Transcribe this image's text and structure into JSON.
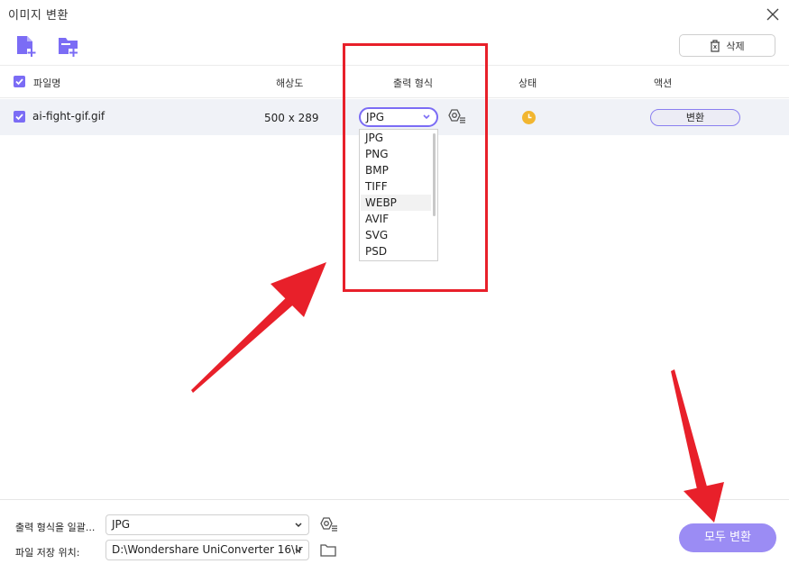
{
  "window": {
    "title": "이미지 변환"
  },
  "toolbar": {
    "add_file_icon": "add-file-icon",
    "add_folder_icon": "add-folder-icon",
    "delete_label": "삭제"
  },
  "table": {
    "headers": {
      "filename": "파일명",
      "resolution": "해상도",
      "output_format": "출력 형식",
      "status": "상태",
      "action": "액션"
    },
    "rows": [
      {
        "filename": "ai-fight-gif.gif",
        "resolution": "500 x 289",
        "format": "JPG",
        "action_label": "변환",
        "checked": true
      }
    ]
  },
  "format_dropdown": {
    "options": [
      "JPG",
      "PNG",
      "BMP",
      "TIFF",
      "WEBP",
      "AVIF",
      "SVG",
      "PSD"
    ],
    "hovered": "WEBP"
  },
  "footer": {
    "output_format_label": "출력 형식을 일괄...",
    "output_format_value": "JPG",
    "save_location_label": "파일 저장 위치:",
    "save_location_value": "D:\\Wondershare UniConverter 16\\Ir",
    "convert_all_label": "모두 변환"
  },
  "colors": {
    "accent": "#7b6cf5",
    "highlight_box": "#e8202a",
    "status_pending": "#f2b630",
    "row_bg": "#f0f2f7"
  }
}
